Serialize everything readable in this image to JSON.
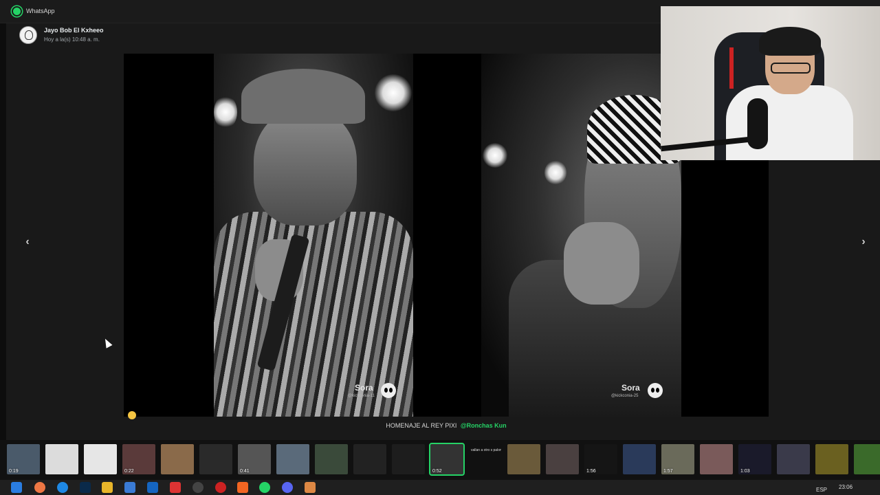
{
  "app": {
    "title": "WhatsApp",
    "accent": "#25d366"
  },
  "sender": {
    "name": "Jayo Bob El Kxheeo",
    "time": "Hoy a la(s) 10:48 a. m."
  },
  "media": {
    "left": {
      "watermark": "Sora",
      "handle": "@kickconia-11"
    },
    "right": {
      "watermark": "Sora",
      "handle": "@kickconia-25"
    }
  },
  "caption": {
    "text": "HOMENAJE AL REY PIXI",
    "mention": "@Ronchas Kun"
  },
  "nav": {
    "prev": "‹",
    "next": "›"
  },
  "thumbnails": [
    {
      "dur": "0:19",
      "color": "#4a5a6a"
    },
    {
      "dur": "",
      "color": "#dcdcdc"
    },
    {
      "dur": "",
      "color": "#e6e6e6"
    },
    {
      "dur": "0:22",
      "color": "#5a3a3a"
    },
    {
      "dur": "",
      "color": "#8a6a4a"
    },
    {
      "dur": "",
      "color": "#2a2a2a"
    },
    {
      "dur": "0:41",
      "color": "#555"
    },
    {
      "dur": "",
      "color": "#5a6a7a"
    },
    {
      "dur": "",
      "color": "#3a4a3a"
    },
    {
      "dur": "",
      "color": "#222"
    },
    {
      "dur": "",
      "color": "#1d1d1d"
    },
    {
      "dur": "0:52",
      "color": "#333"
    },
    {
      "dur": "",
      "color": "#111",
      "text": "vallan a otro s paloma el quie Tigo"
    },
    {
      "dur": "",
      "color": "#6a5a3a"
    },
    {
      "dur": "",
      "color": "#4a4040"
    },
    {
      "dur": "1:56",
      "color": "#151515"
    },
    {
      "dur": "",
      "color": "#2a3a5a"
    },
    {
      "dur": "1:57",
      "color": "#6a6a5a"
    },
    {
      "dur": "",
      "color": "#7a5a5a"
    },
    {
      "dur": "1:03",
      "color": "#1a1a2a"
    },
    {
      "dur": "",
      "color": "#3a3a4a"
    },
    {
      "dur": "",
      "color": "#6a6020"
    },
    {
      "dur": "",
      "color": "#3a6a2a"
    }
  ],
  "taskbar": {
    "lang": "ESP",
    "clock": "23:06"
  }
}
